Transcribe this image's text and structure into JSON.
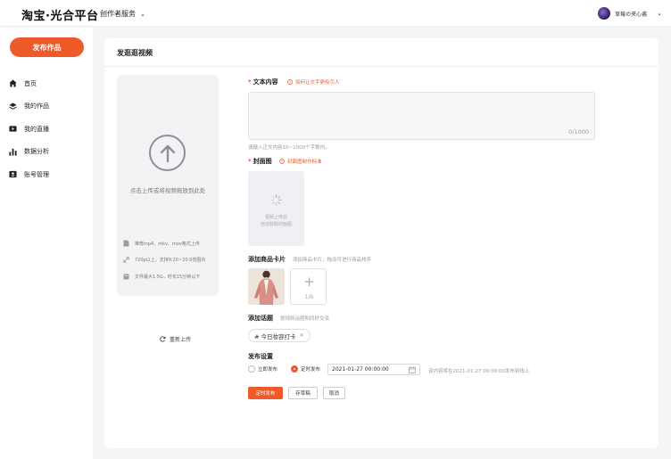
{
  "header": {
    "logo": "淘宝·光合平台",
    "service_menu": "创作者服务",
    "username": "草莓の夹心酱"
  },
  "sidebar": {
    "publish_button": "发布作品",
    "items": [
      {
        "label": "首页",
        "icon": "home-icon"
      },
      {
        "label": "我的作品",
        "icon": "layers-icon"
      },
      {
        "label": "我的直播",
        "icon": "video-icon"
      },
      {
        "label": "数据分析",
        "icon": "bar-chart-icon"
      },
      {
        "label": "账号管理",
        "icon": "id-card-icon"
      }
    ]
  },
  "main": {
    "title": "发逛逛视频",
    "upload": {
      "tip": "点击上传或将视频拖放到此处",
      "specs": [
        "推荐mp4、mkv、mov格式上传",
        "720p以上，支持9:20~20:9范围内",
        "文件最大1.5G，时长15分钟以下"
      ],
      "reupload": "重新上传"
    },
    "text_content": {
      "label": "文本内容",
      "help_link": "如何让文字更吸引人",
      "counter": "0/1000",
      "hint": "请输入正文内容10~1000个字数内。"
    },
    "cover": {
      "label": "封面图",
      "help_link": "封面图制作标准",
      "placeholder_line1": "视频上传后",
      "placeholder_line2": "自动获取封面图"
    },
    "product": {
      "label": "添加商品卡片",
      "hint": "添加商品卡片，拖动可进行商品排序",
      "add_plus": "+",
      "count": "1/6"
    },
    "topic": {
      "label": "添加话题",
      "hint": "按规则话题和同好交流",
      "tag": "# 今日妆容打卡"
    },
    "publish": {
      "label": "发布设置",
      "option_now": "立即发布",
      "option_scheduled": "定时发布",
      "selected": "定时发布",
      "datetime": "2021-01-27 00:00:00",
      "schedule_hint": "该内容将在2021-01-27 00:00:00发布到线上"
    },
    "actions": {
      "submit": "定时发布",
      "draft": "存草稿",
      "cancel": "取消"
    }
  },
  "colors": {
    "accent": "#ef5a2a",
    "page_bg": "#f4f5f7",
    "upload_bg": "#f2f3f5"
  }
}
